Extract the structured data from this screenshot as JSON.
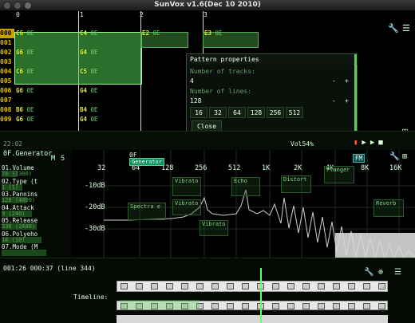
{
  "window": {
    "title": "SunVox v1.6(Dec 10 2010)"
  },
  "pattern": {
    "track_numbers": [
      "0",
      "1",
      "2",
      "3"
    ],
    "row_first": "000",
    "rows": [
      "000",
      "001",
      "002",
      "003",
      "004",
      "005",
      "006",
      "007",
      "008",
      "009"
    ],
    "tracks": [
      {
        "cells": [
          {
            "note": "C6",
            "eff": "0E"
          },
          {
            "note": "",
            "eff": ""
          },
          {
            "note": "G6",
            "eff": "0E"
          },
          {
            "note": "",
            "eff": ""
          },
          {
            "note": "C6",
            "eff": "0E"
          },
          {
            "note": "",
            "eff": ""
          },
          {
            "note": "G6",
            "eff": "0E"
          },
          {
            "note": "",
            "eff": ""
          },
          {
            "note": "B6",
            "eff": "0E"
          },
          {
            "note": "G6",
            "eff": "0E"
          }
        ]
      },
      {
        "cells": [
          {
            "note": "C4",
            "eff": "0E"
          },
          {
            "note": "",
            "eff": ""
          },
          {
            "note": "G4",
            "eff": "0E"
          },
          {
            "note": "",
            "eff": ""
          },
          {
            "note": "C5",
            "eff": "0E"
          },
          {
            "note": "",
            "eff": ""
          },
          {
            "note": "G4",
            "eff": "0E"
          },
          {
            "note": "",
            "eff": ""
          },
          {
            "note": "B4",
            "eff": "0E"
          },
          {
            "note": "G4",
            "eff": "0E"
          }
        ]
      },
      {
        "cells": [
          {
            "note": "E2",
            "eff": "0E"
          },
          {
            "note": "",
            "eff": ""
          },
          {
            "note": "",
            "eff": ""
          },
          {
            "note": "",
            "eff": ""
          },
          {
            "note": "",
            "eff": ""
          },
          {
            "note": "",
            "eff": ""
          },
          {
            "note": "",
            "eff": ""
          },
          {
            "note": "",
            "eff": ""
          },
          {
            "note": "",
            "eff": ""
          },
          {
            "note": "",
            "eff": ""
          }
        ]
      },
      {
        "cells": [
          {
            "note": "E3",
            "eff": "0E"
          },
          {
            "note": "",
            "eff": ""
          },
          {
            "note": "",
            "eff": ""
          },
          {
            "note": "",
            "eff": ""
          },
          {
            "note": "",
            "eff": ""
          },
          {
            "note": "",
            "eff": ""
          },
          {
            "note": "",
            "eff": ""
          },
          {
            "note": "",
            "eff": ""
          },
          {
            "note": "",
            "eff": ""
          },
          {
            "note": "",
            "eff": ""
          }
        ]
      }
    ]
  },
  "props": {
    "title": "Pattern properties",
    "tracks_label": "Number of tracks:",
    "tracks_value": "4",
    "lines_label": "Number of lines:",
    "lines_value": "128",
    "minus": "-",
    "plus": "+",
    "presets": [
      "16",
      "32",
      "64",
      "128",
      "256",
      "512"
    ],
    "close": "Close"
  },
  "status": {
    "clock": "22:02",
    "volume": "Vol54%"
  },
  "module": {
    "name": "0F.Generator",
    "m_label": "M",
    "s_label": "S",
    "controls": [
      {
        "name": "01.Volume",
        "sub": "70 (2300)"
      },
      {
        "name": "02.Type (t",
        "sub": "1 (1)"
      },
      {
        "name": "03.Pannins",
        "sub": "128 (4000)"
      },
      {
        "name": "04.Attack",
        "sub": "9 (240)"
      },
      {
        "name": "05.Release",
        "sub": "336 (2A00)"
      },
      {
        "name": "06.Polyeho",
        "sub": "16 (10)"
      },
      {
        "name": "07.Mode (M",
        "sub": ""
      }
    ]
  },
  "spectrum": {
    "frequencies": [
      "32",
      "64",
      "128",
      "256",
      "512",
      "1K",
      "2K",
      "4K",
      "8K",
      "16K"
    ],
    "db": [
      "-10dB",
      "-20dB",
      "-30dB"
    ],
    "node_label": "0F",
    "generator_badge": "Generator",
    "fm_badge": "FM",
    "nodes": [
      "Echo",
      "Vibrato",
      "Vibrato",
      "Vibrato",
      "Spectra e",
      "Distort",
      "Flanger",
      "Reverb"
    ]
  },
  "timeline": {
    "info": "001:26 000:37 (line 344)",
    "label": "Timeline:"
  }
}
